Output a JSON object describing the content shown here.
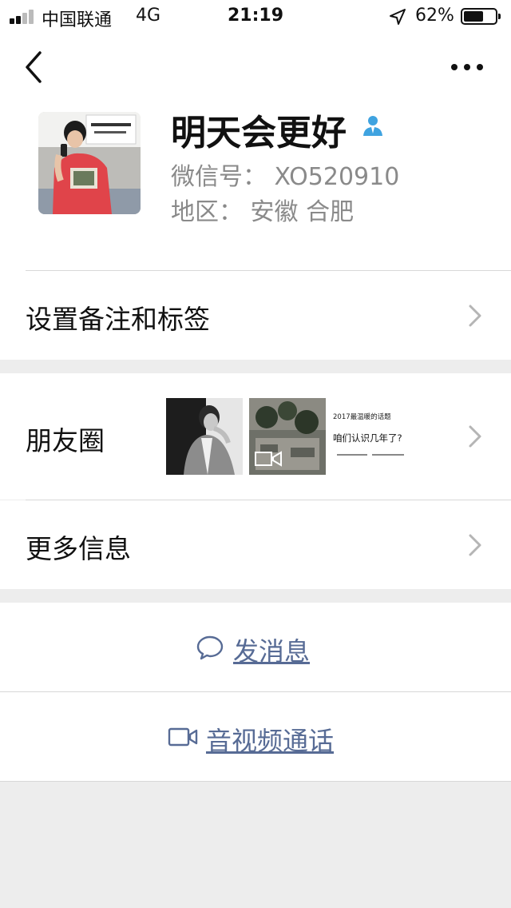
{
  "status_bar": {
    "carrier": "中国联通",
    "network": "4G",
    "time": "21:19",
    "battery_percent": "62%",
    "battery_level": 0.62,
    "icons": [
      "signal-bars-icon",
      "location-arrow-icon",
      "battery-icon"
    ]
  },
  "nav": {
    "icons": [
      "chevron-left-icon",
      "more-dots-icon"
    ]
  },
  "profile": {
    "name": "明天会更好",
    "wechat_id": "微信号： XO520910",
    "region": "地区： 安徽 合肥",
    "icons": [
      "avatar-photo",
      "person-badge-icon"
    ],
    "badge_color": "#3fa3e0"
  },
  "rows": {
    "remark_tags": "设置备注和标签",
    "moments": "朋友圈",
    "more_info": "更多信息"
  },
  "moments_thumbs": {
    "third_title": "2017最温暖的话题",
    "third_main": "咱们认识几年了?"
  },
  "actions": {
    "send_message": "发消息",
    "video_call": "音视频通话",
    "link_color": "#576b95"
  }
}
